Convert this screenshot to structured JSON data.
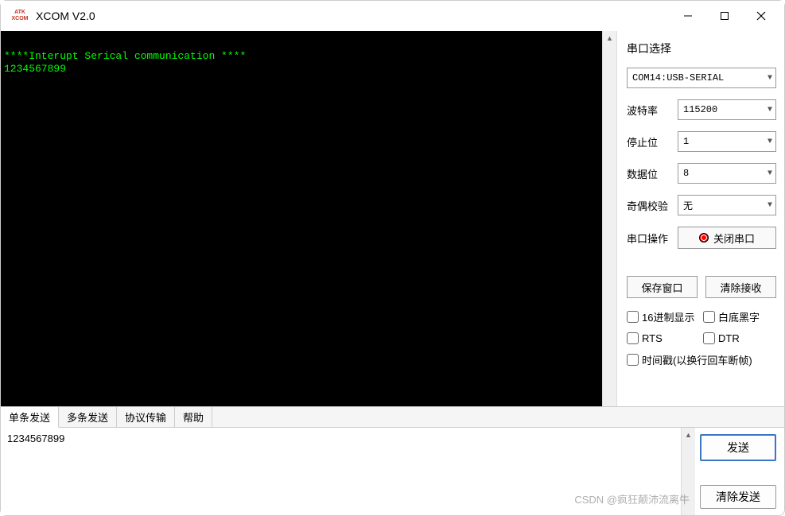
{
  "window": {
    "title": "XCOM V2.0",
    "icon_text_top": "ATK",
    "icon_text_bottom": "XCOM"
  },
  "terminal": {
    "line1": "****Interupt Serical communication ****",
    "line2": "1234567899"
  },
  "panel": {
    "port_select_label": "串口选择",
    "port_value": "COM14:USB-SERIAL",
    "baud_label": "波特率",
    "baud_value": "115200",
    "stopbits_label": "停止位",
    "stopbits_value": "1",
    "databits_label": "数据位",
    "databits_value": "8",
    "parity_label": "奇偶校验",
    "parity_value": "无",
    "port_op_label": "串口操作",
    "port_op_btn": "关闭串口",
    "save_window_btn": "保存窗口",
    "clear_recv_btn": "清除接收",
    "hex_display_label": "16进制显示",
    "white_bg_label": "白底黑字",
    "rts_label": "RTS",
    "dtr_label": "DTR",
    "timestamp_label": "时间戳(以换行回车断帧)"
  },
  "tabs": {
    "single_send": "单条发送",
    "multi_send": "多条发送",
    "protocol": "协议传输",
    "help": "帮助"
  },
  "send": {
    "input_value": "1234567899",
    "send_btn": "发送",
    "clear_send_btn": "清除发送"
  },
  "watermark": "CSDN @疯狂颠沛流离牛"
}
